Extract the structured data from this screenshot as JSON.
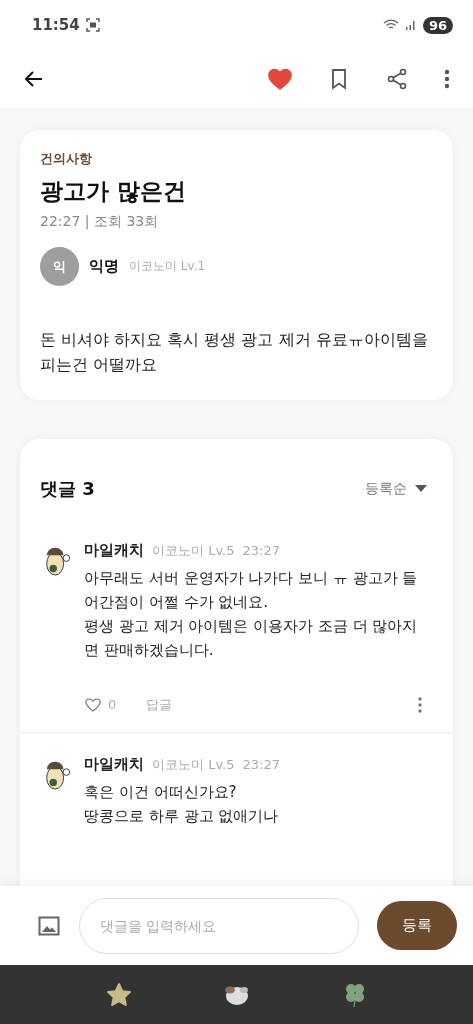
{
  "status_bar": {
    "time": "11:54",
    "battery": "96"
  },
  "top_bar": {
    "liked": true
  },
  "post": {
    "category": "건의사항",
    "title": "광고가 많은건",
    "meta": "22:27 | 조회 33회",
    "author": {
      "avatar_letter": "익",
      "name": "익명",
      "level": "이코노미 Lv.1"
    },
    "body": "돈 비셔야 하지요 혹시 평생 광고 제거 유료ㅠ아이템을 피는건 어떨까요"
  },
  "comments": {
    "title": "댓글 3",
    "sort": "등록순",
    "items": [
      {
        "name": "마일캐치",
        "level": "이코노미 Lv.5",
        "time": "23:27",
        "text": "아무래도 서버 운영자가 나가다 보니 ㅠ 광고가 들어간점이 어쩔 수가 없네요.\n평생 광고 제거 아이템은 이용자가 조금 더 많아지면 판매하겠습니다.",
        "likes": "0",
        "reply": "답글"
      },
      {
        "name": "마일캐치",
        "level": "이코노미 Lv.5",
        "time": "23:27",
        "text": "혹은 이건 어떠신가요?\n땅콩으로 하루 광고 없애기나"
      }
    ]
  },
  "composer": {
    "placeholder": "댓글을 입력하세요",
    "submit": "등록"
  }
}
